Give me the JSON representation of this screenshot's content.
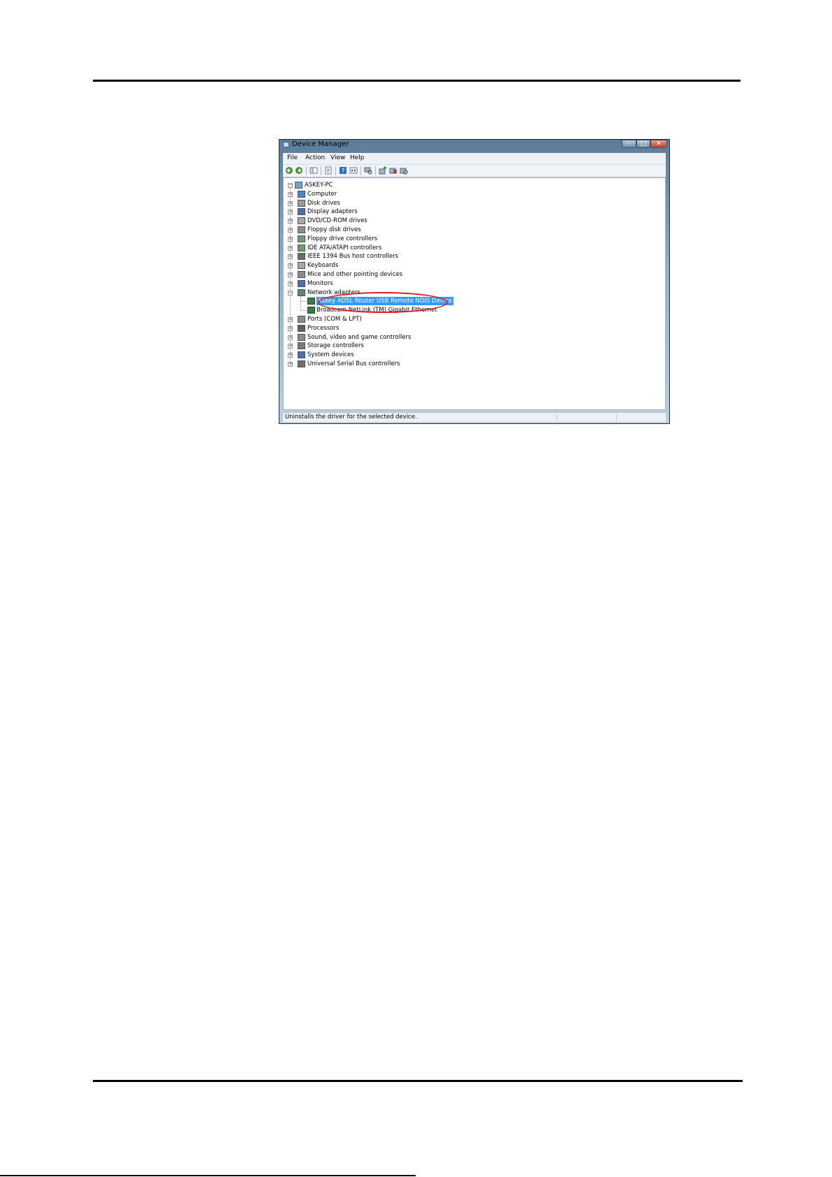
{
  "window": {
    "title": "Device Manager",
    "caption_min": "–",
    "caption_max": "□",
    "caption_close": "✕"
  },
  "menu": [
    "File",
    "Action",
    "View",
    "Help"
  ],
  "toolbar_icons": [
    "back-icon",
    "forward-icon",
    "show-hide-tree-icon",
    "properties-icon",
    "help-icon",
    "view-icon",
    "scan-hardware-icon",
    "update-driver-icon",
    "uninstall-icon",
    "disable-icon"
  ],
  "tree": {
    "root": "ASKEY-PC",
    "categories": [
      {
        "label": "Computer",
        "icon": "computer-icon",
        "color": "#3a6fb5"
      },
      {
        "label": "Disk drives",
        "icon": "disk-drive-icon",
        "color": "#8a8a8a"
      },
      {
        "label": "Display adapters",
        "icon": "display-adapter-icon",
        "color": "#2c5a9c"
      },
      {
        "label": "DVD/CD-ROM drives",
        "icon": "dvd-drive-icon",
        "color": "#9a9a9a"
      },
      {
        "label": "Floppy disk drives",
        "icon": "floppy-drive-icon",
        "color": "#7a7a7a"
      },
      {
        "label": "Floppy drive controllers",
        "icon": "floppy-controller-icon",
        "color": "#5a8a5a"
      },
      {
        "label": "IDE ATA/ATAPI controllers",
        "icon": "ide-controller-icon",
        "color": "#5a8a5a"
      },
      {
        "label": "IEEE 1394 Bus host controllers",
        "icon": "firewire-icon",
        "color": "#555555"
      },
      {
        "label": "Keyboards",
        "icon": "keyboard-icon",
        "color": "#9a9a9a"
      },
      {
        "label": "Mice and other pointing devices",
        "icon": "mouse-icon",
        "color": "#777777"
      },
      {
        "label": "Monitors",
        "icon": "monitor-icon",
        "color": "#2c5a9c"
      },
      {
        "label": "Network adapters",
        "icon": "network-adapter-icon",
        "color": "#3a7a4a",
        "expanded": true
      },
      {
        "label": "Ports (COM & LPT)",
        "icon": "port-icon",
        "color": "#777777"
      },
      {
        "label": "Processors",
        "icon": "processor-icon",
        "color": "#444444"
      },
      {
        "label": "Sound, video and game controllers",
        "icon": "sound-icon",
        "color": "#777777"
      },
      {
        "label": "Storage controllers",
        "icon": "storage-controller-icon",
        "color": "#666666"
      },
      {
        "label": "System devices",
        "icon": "system-device-icon",
        "color": "#2c5a9c"
      },
      {
        "label": "Universal Serial Bus controllers",
        "icon": "usb-icon",
        "color": "#555555"
      }
    ],
    "network_children": [
      {
        "label": "Askey ADSL Router USB Remote NDIS Device",
        "selected": true
      },
      {
        "label": "Broadcom NetLink (TM) Gigabit Ethernet",
        "selected": false
      }
    ],
    "expander_collapsed": "+",
    "expander_expanded": "−"
  },
  "status": "Uninstalls the driver for the selected device.",
  "colors": {
    "selection": "#3399ff",
    "highlight_ellipse": "#e21b1b"
  }
}
